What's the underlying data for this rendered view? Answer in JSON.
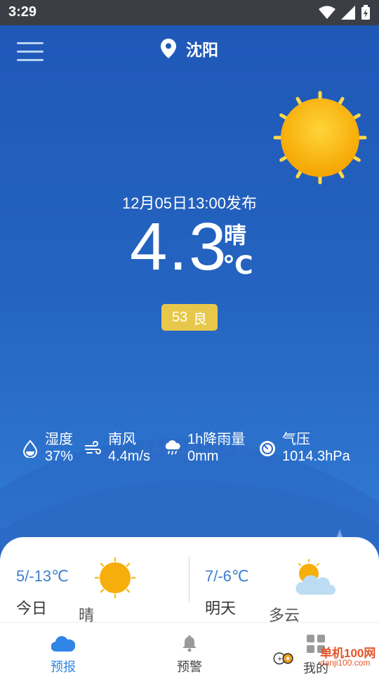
{
  "status_bar": {
    "time": "3:29"
  },
  "header": {
    "city": "沈阳"
  },
  "current": {
    "publish_time": "12月05日13:00发布",
    "temperature": "4.3",
    "unit": "℃",
    "weather": "晴",
    "aqi_value": "53",
    "aqi_level": "良",
    "aqi_color": "#e8c84a"
  },
  "stats": [
    {
      "label": "湿度",
      "value": "37%",
      "icon": "humidity-icon"
    },
    {
      "label": "南风",
      "value": "4.4m/s",
      "icon": "wind-icon"
    },
    {
      "label": "1h降雨量",
      "value": "0mm",
      "icon": "rain-icon"
    },
    {
      "label": "气压",
      "value": "1014.3hPa",
      "icon": "pressure-icon"
    }
  ],
  "forecast": {
    "today": {
      "temp": "5/-13℃",
      "day": "今日",
      "cond": "晴",
      "icon": "sun-icon"
    },
    "tomorrow": {
      "temp": "7/-6℃",
      "day": "明天",
      "cond": "多云",
      "icon": "partly-cloudy-icon"
    }
  },
  "nav": {
    "items": [
      {
        "label": "预报",
        "icon": "cloud-icon",
        "active": true
      },
      {
        "label": "预警",
        "icon": "bell-icon",
        "active": false
      },
      {
        "label": "我的",
        "icon": "grid-icon",
        "active": false
      }
    ]
  },
  "watermark": {
    "text": "单机100网",
    "url": "danji100.com"
  },
  "colors": {
    "accent": "#2f86e6",
    "sky_top": "#2058b8",
    "sun": "#f5b400"
  }
}
